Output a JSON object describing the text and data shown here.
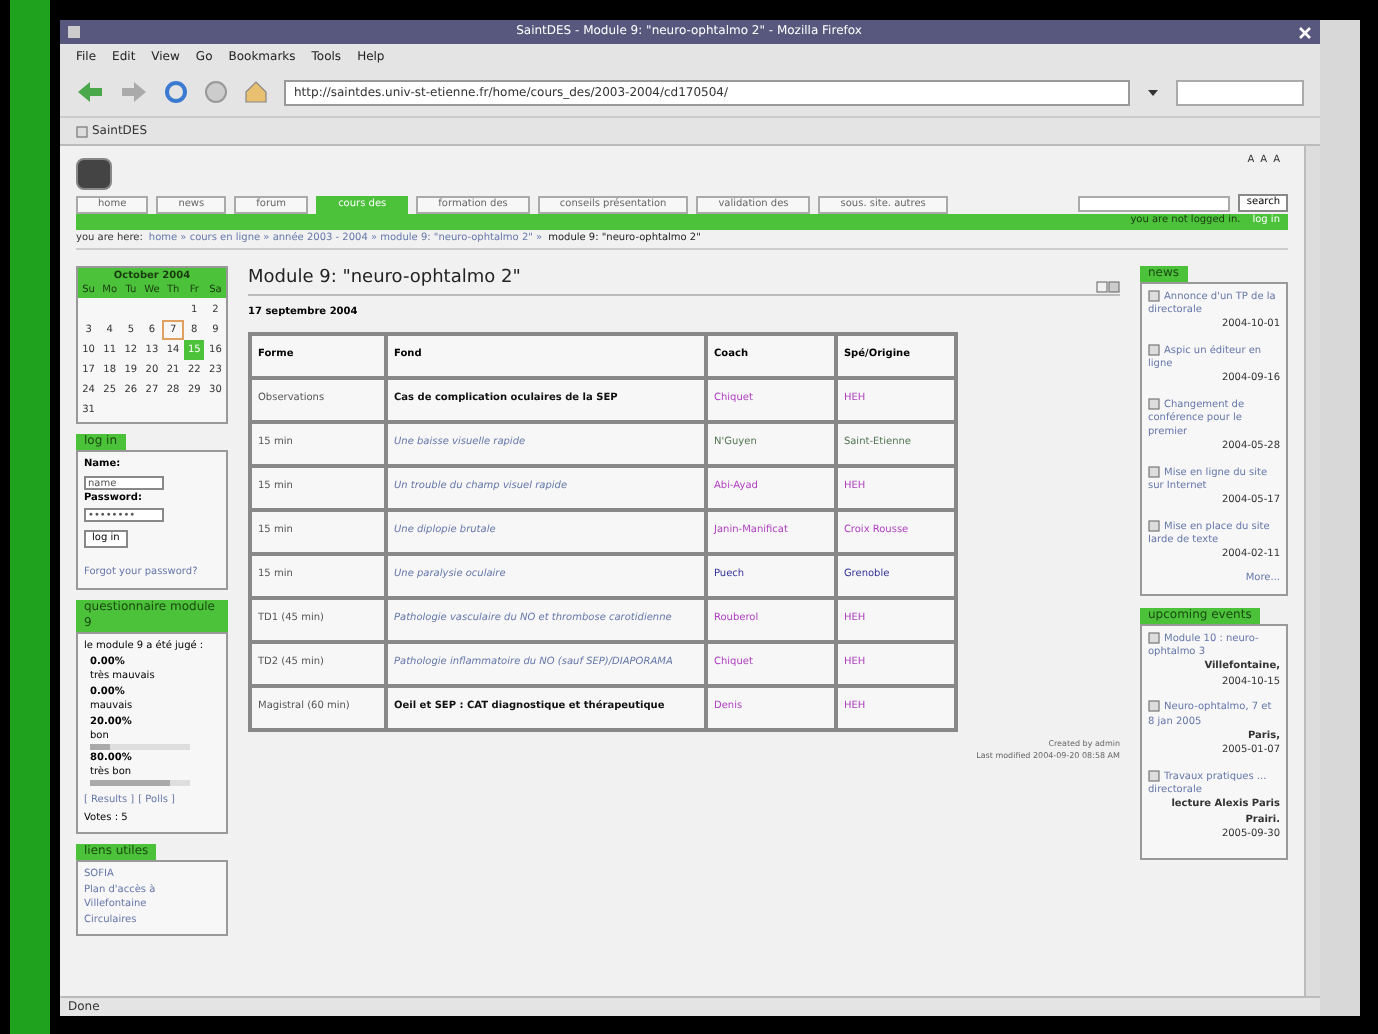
{
  "window": {
    "title": "SaintDES - Module 9: \"neuro-ophtalmo 2\" - Mozilla Firefox"
  },
  "menu": [
    "File",
    "Edit",
    "View",
    "Go",
    "Bookmarks",
    "Tools",
    "Help"
  ],
  "address": {
    "value": "http://saintdes.univ-st-etienne.fr/home/cours_des/2003-2004/cd170504/"
  },
  "bookmarks": [
    "SaintDES"
  ],
  "font_sizes": [
    "A",
    "A",
    "A"
  ],
  "search": {
    "button": "search"
  },
  "tabs": [
    {
      "label": "home",
      "selected": false
    },
    {
      "label": "news",
      "selected": false
    },
    {
      "label": "forum",
      "selected": false
    },
    {
      "label": "cours des",
      "selected": true
    },
    {
      "label": "formation des",
      "selected": false
    },
    {
      "label": "conseils présentation",
      "selected": false
    },
    {
      "label": "validation des",
      "selected": false
    },
    {
      "label": "sous. site. autres",
      "selected": false
    }
  ],
  "login_bar": {
    "text": "you are not logged in.",
    "link": "log in"
  },
  "breadcrumb": {
    "label": "you are here:",
    "path": "home » cours en ligne » année 2003 - 2004 » module 9: \"neuro-ophtalmo 2\" »",
    "current": "module 9: \"neuro-ophtalmo 2\""
  },
  "calendar": {
    "title": "October 2004",
    "weekdays": [
      "Su",
      "Mo",
      "Tu",
      "We",
      "Th",
      "Fr",
      "Sa"
    ],
    "weeks": [
      [
        {
          "day": "1",
          "selected": false,
          "today": false
        },
        {
          "day": "2",
          "selected": false,
          "today": false
        }
      ],
      [
        {
          "day": "3",
          "selected": false,
          "today": false
        },
        {
          "day": "4",
          "selected": false,
          "today": false
        },
        {
          "day": "5",
          "selected": false,
          "today": false
        },
        {
          "day": "6",
          "selected": false,
          "today": false
        },
        {
          "day": "7",
          "selected": false,
          "today": true
        },
        {
          "day": "8",
          "selected": false,
          "today": false
        },
        {
          "day": "9",
          "selected": false,
          "today": false
        }
      ],
      [
        {
          "day": "10",
          "selected": false,
          "today": false
        },
        {
          "day": "11",
          "selected": false,
          "today": false
        },
        {
          "day": "12",
          "selected": false,
          "today": false
        },
        {
          "day": "13",
          "selected": false,
          "today": false
        },
        {
          "day": "14",
          "selected": false,
          "today": false
        },
        {
          "day": "15",
          "selected": true,
          "today": false
        },
        {
          "day": "16",
          "selected": false,
          "today": false
        }
      ],
      [
        {
          "day": "17",
          "selected": false,
          "today": false
        },
        {
          "day": "18",
          "selected": false,
          "today": false
        },
        {
          "day": "19",
          "selected": false,
          "today": false
        },
        {
          "day": "20",
          "selected": false,
          "today": false
        },
        {
          "day": "21",
          "selected": false,
          "today": false
        },
        {
          "day": "22",
          "selected": false,
          "today": false
        },
        {
          "day": "23",
          "selected": false,
          "today": false
        }
      ],
      [
        {
          "day": "24",
          "selected": false,
          "today": false
        },
        {
          "day": "25",
          "selected": false,
          "today": false
        },
        {
          "day": "26",
          "selected": false,
          "today": false
        },
        {
          "day": "27",
          "selected": false,
          "today": false
        },
        {
          "day": "28",
          "selected": false,
          "today": false
        },
        {
          "day": "29",
          "selected": false,
          "today": false
        },
        {
          "day": "30",
          "selected": false,
          "today": false
        }
      ],
      [
        {
          "day": "31",
          "selected": false,
          "today": false
        }
      ]
    ]
  },
  "login_box": {
    "title": "log in",
    "name_label": "Name:",
    "name_value": "name",
    "password_label": "Password:",
    "password_value": "••••••••",
    "button": "log in",
    "forgot": "Forgot your password?"
  },
  "poll": {
    "title": "questionnaire module 9",
    "question": "le module 9 a été jugé :",
    "answers": [
      {
        "percent": "0.00%",
        "label": "très mauvais"
      },
      {
        "percent": "0.00%",
        "label": "mauvais"
      },
      {
        "percent": "20.00%",
        "label": "bon",
        "level": 0.2
      },
      {
        "percent": "80.00%",
        "label": "très bon",
        "level": 0.8
      }
    ],
    "links": [
      "[ Results ]",
      "[ Polls ]"
    ],
    "votes": "Votes : 5"
  },
  "useful_links": {
    "title": "liens utiles",
    "items": [
      "SOFIA",
      "Plan d'accès à Villefontaine",
      "Circulaires"
    ]
  },
  "module": {
    "title": "Module 9: \"neuro-ophtalmo 2\"",
    "date": "17 septembre 2004",
    "columns": [
      "Forme",
      "Fond",
      "Coach",
      "Spé/Origine"
    ],
    "rows": [
      {
        "forme": "Observations",
        "fond": {
          "text": "Cas de complication oculaires de la SEP",
          "kind": "bold"
        },
        "coach": {
          "text": "Chiquet",
          "color": "#b040c0"
        },
        "origin": {
          "text": "HEH",
          "color": "#b040c0"
        }
      },
      {
        "forme": "15 min",
        "fond": {
          "text": "Une baisse visuelle rapide",
          "kind": "link"
        },
        "coach": {
          "text": "N'Guyen",
          "color": "#557755"
        },
        "origin": {
          "text": "Saint-Etienne",
          "color": "#557755"
        }
      },
      {
        "forme": "15 min",
        "fond": {
          "text": "Un trouble du champ visuel rapide",
          "kind": "link"
        },
        "coach": {
          "text": "Abi-Ayad",
          "color": "#b040c0"
        },
        "origin": {
          "text": "HEH",
          "color": "#b040c0"
        }
      },
      {
        "forme": "15 min",
        "fond": {
          "text": "Une diplopie brutale",
          "kind": "link"
        },
        "coach": {
          "text": "Janin-Manificat",
          "color": "#b040c0"
        },
        "origin": {
          "text": "Croix Rousse",
          "color": "#b040c0"
        }
      },
      {
        "forme": "15 min",
        "fond": {
          "text": "Une paralysie oculaire",
          "kind": "link"
        },
        "coach": {
          "text": "Puech",
          "color": "#333399"
        },
        "origin": {
          "text": "Grenoble",
          "color": "#333399"
        }
      },
      {
        "forme": "TD1 (45 min)",
        "fond": {
          "text": "Pathologie vasculaire du NO et thrombose carotidienne",
          "kind": "link"
        },
        "coach": {
          "text": "Rouberol",
          "color": "#b040c0"
        },
        "origin": {
          "text": "HEH",
          "color": "#b040c0"
        }
      },
      {
        "forme": "TD2 (45 min)",
        "fond": {
          "text": "Pathologie inflammatoire du NO (sauf SEP)/DIAPORAMA",
          "kind": "link"
        },
        "coach": {
          "text": "Chiquet",
          "color": "#b040c0"
        },
        "origin": {
          "text": "HEH",
          "color": "#b040c0"
        }
      },
      {
        "forme": "Magistral (60 min)",
        "fond": {
          "text": "Oeil et SEP : CAT diagnostique et thérapeutique",
          "kind": "bold"
        },
        "coach": {
          "text": "Denis",
          "color": "#b040c0"
        },
        "origin": {
          "text": "HEH",
          "color": "#b040c0"
        }
      }
    ],
    "created": "Created by admin",
    "modified": "Last modified 2004-09-20 08:58 AM"
  },
  "news": {
    "title": "news",
    "items": [
      {
        "title": "Annonce d'un TP de la directorale",
        "date": "2004-10-01"
      },
      {
        "title": "Aspic un éditeur en ligne",
        "date": "2004-09-16"
      },
      {
        "title": "Changement de conférence pour le premier",
        "date": "2004-05-28"
      },
      {
        "title": "Mise en ligne du site sur Internet",
        "date": "2004-05-17"
      },
      {
        "title": "Mise en place du site Iarde de texte",
        "date": "2004-02-11"
      }
    ],
    "more": "More..."
  },
  "events": {
    "title": "upcoming events",
    "items": [
      {
        "title": "Module 10 : neuro-ophtalmo 3",
        "place": "Villefontaine,",
        "date": "2004-10-15"
      },
      {
        "title": "Neuro-ophtalmo, 7 et 8 jan 2005",
        "place": "Paris,",
        "date": "2005-01-07"
      },
      {
        "title": "Travaux pratiques ... directorale",
        "place": "lecture Alexis Paris Prairi.",
        "date": "2005-09-30"
      }
    ]
  },
  "status_bar": "Done"
}
